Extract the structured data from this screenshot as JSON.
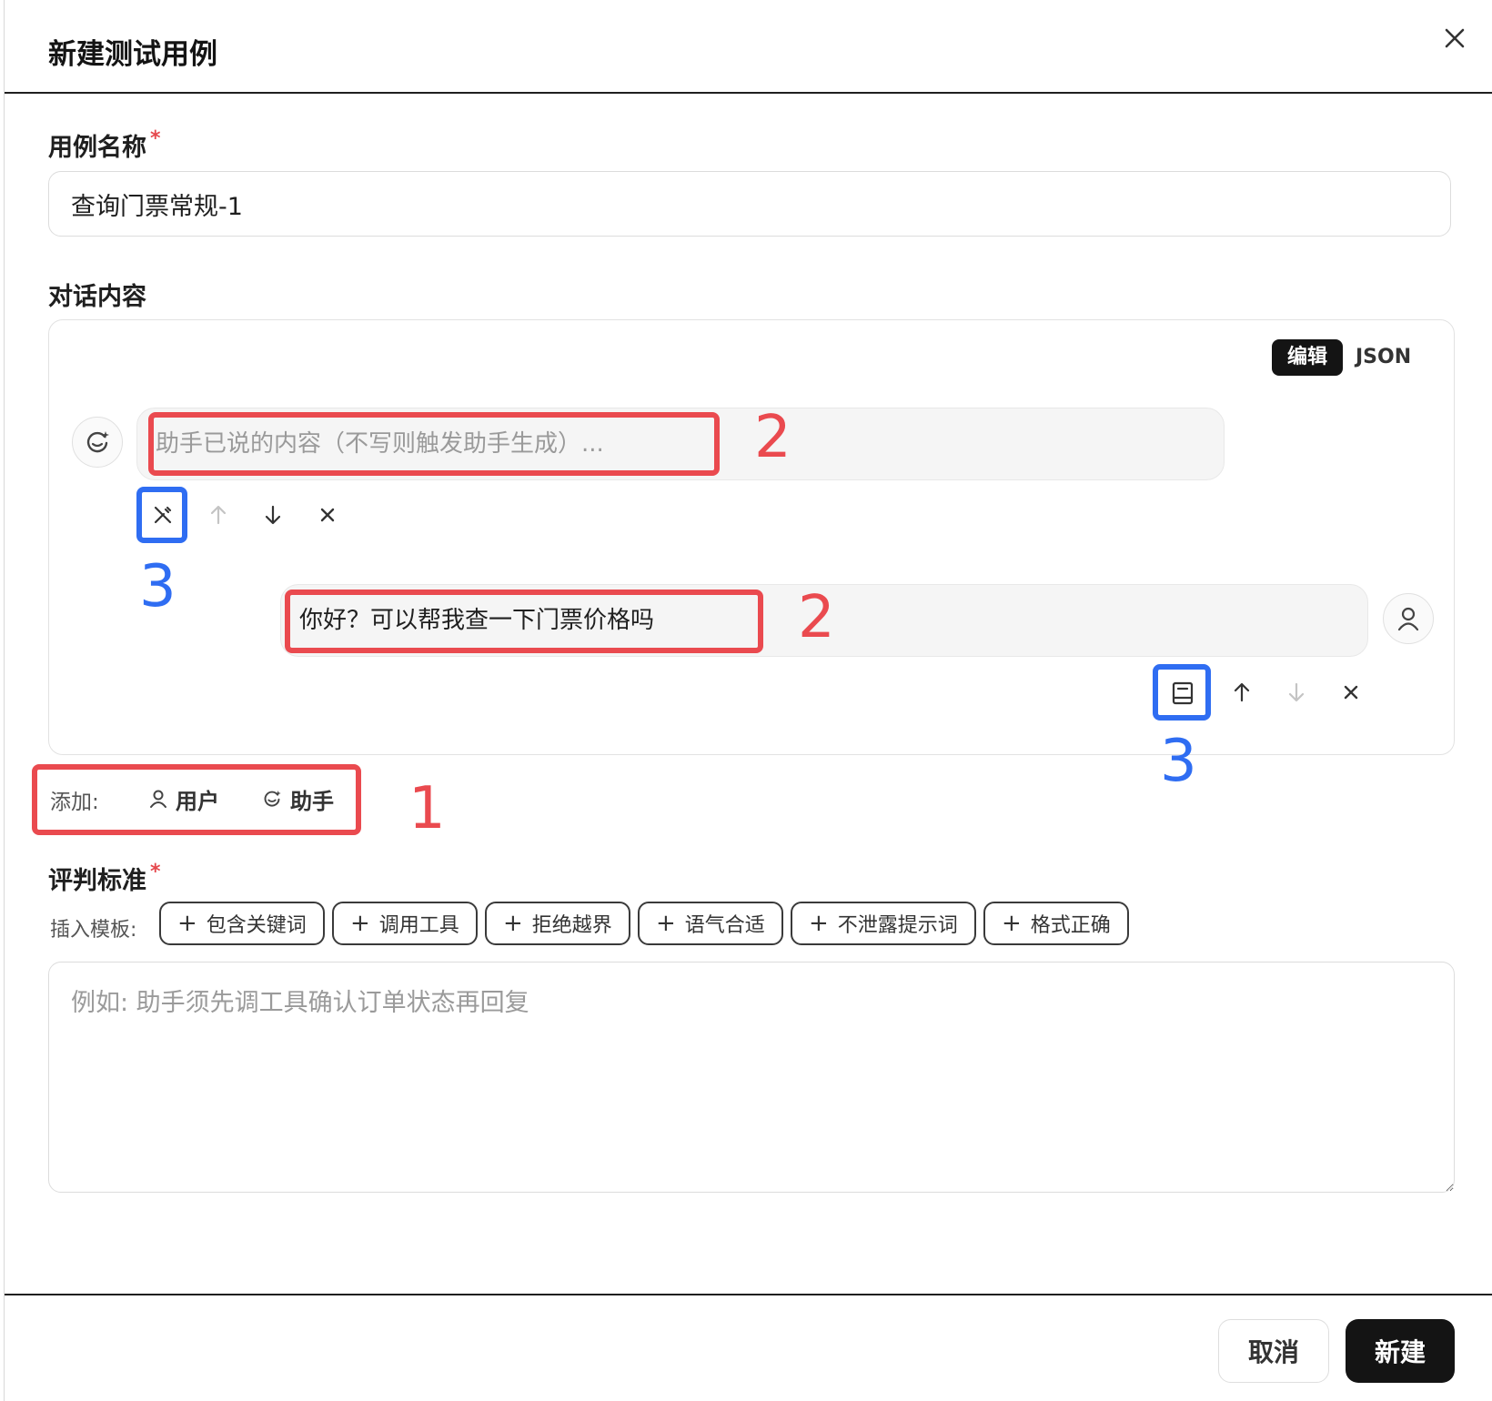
{
  "dialog": {
    "title": "新建测试用例"
  },
  "case_name": {
    "label": "用例名称",
    "required_mark": "*",
    "value": "查询门票常规-1"
  },
  "conversation": {
    "label": "对话内容",
    "mode_edit": "编辑",
    "mode_json": "JSON",
    "messages": [
      {
        "role": "assistant",
        "placeholder": "助手已说的内容（不写则触发助手生成）..."
      },
      {
        "role": "user",
        "text": "你好？可以帮我查一下门票价格吗"
      }
    ],
    "add_label": "添加:",
    "add_user": "用户",
    "add_assistant": "助手"
  },
  "criteria": {
    "label": "评判标准",
    "required_mark": "*",
    "template_label": "插入模板:",
    "templates": [
      "包含关键词",
      "调用工具",
      "拒绝越界",
      "语气合适",
      "不泄露提示词",
      "格式正确"
    ],
    "placeholder": "例如: 助手须先调工具确认订单状态再回复"
  },
  "annotations": {
    "n1": "1",
    "n2a": "2",
    "n2b": "2",
    "n3a": "3",
    "n3b": "3"
  },
  "footer": {
    "cancel": "取消",
    "create": "新建"
  },
  "colors": {
    "annotation_red": "#ea4a4f",
    "annotation_blue": "#2f6df2",
    "primary_button": "#141414"
  }
}
